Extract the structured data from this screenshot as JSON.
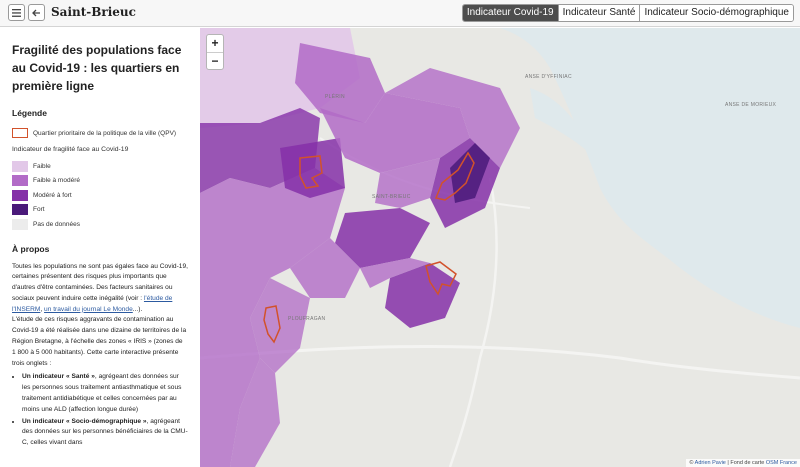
{
  "header": {
    "brand": "Saint-Brieuc",
    "menu_icon": "menu-icon",
    "back_icon": "back-arrow-icon",
    "tabs": [
      {
        "label": "Indicateur Covid-19",
        "active": true
      },
      {
        "label": "Indicateur Santé",
        "active": false
      },
      {
        "label": "Indicateur Socio-démographique",
        "active": false
      }
    ]
  },
  "sidebar": {
    "title": "Fragilité des populations face au Covid-19 : les quartiers en première ligne",
    "legend_heading": "Légende",
    "qpv_label": "Quartier prioritaire de la politique de la ville (QPV)",
    "indicator_title": "Indicateur de fragilité face au Covid-19",
    "legend_items": [
      {
        "label": "Faible",
        "color": "#e2c8e8"
      },
      {
        "label": "Faible à modéré",
        "color": "#b26bc7"
      },
      {
        "label": "Modéré à fort",
        "color": "#8530a8"
      },
      {
        "label": "Fort",
        "color": "#4a1a7a"
      },
      {
        "label": "Pas de données",
        "color": "#ececec"
      }
    ],
    "about_heading": "À propos",
    "about_p1_a": "Toutes les populations ne sont pas égales face au Covid-19, certaines présentent des risques plus importants que d'autres d'être contaminées. Des facteurs sanitaires ou sociaux peuvent induire cette inégalité (voir : ",
    "about_link1": "l'étude de l'INSERM",
    "about_sep": ", ",
    "about_link2": "un travail du journal Le Monde",
    "about_p1_b": "...).",
    "about_p2": "L'étude de ces risques aggravants de contamination au Covid-19 a été réalisée dans une dizaine de territoires de la Région Bretagne, à l'échelle des zones « IRIS » (zones de 1 800 à 5 000 habitants). Cette carte interactive présente trois onglets :",
    "bullets": [
      {
        "bold": "Un indicateur « Santé »",
        "text": ", agrégeant des données sur les personnes sous traitement antiasthmatique et sous traitement antidiabétique et celles concernées par au moins une ALD (affection longue durée)"
      },
      {
        "bold": "Un indicateur « Socio-démographique »",
        "text": ", agrégeant des données sur les personnes bénéficiaires de la CMU-C, celles vivant dans"
      }
    ]
  },
  "map": {
    "zoom_in": "+",
    "zoom_out": "−",
    "places": {
      "anse_hillion": "Anse d'Yffiniac",
      "anse_hillion2": "Anse de Morieux",
      "saint_brieuc": "SAINT-BRIEUC",
      "plerin": "PLÉRIN",
      "ploufragan": "PLOUFRAGAN"
    },
    "attribution_a": "© ",
    "attribution_link1": "Adrien Pavie",
    "attribution_b": " | Fond de carte ",
    "attribution_link2": "OSM France",
    "colors": {
      "sea": "#dfe9ec",
      "land": "#eaeae6",
      "faible": "#e2c8e8",
      "faible_modere": "#b26bc7",
      "modere_fort": "#8530a8",
      "fort": "#4a1a7a",
      "qpv": "#d2522b"
    }
  }
}
